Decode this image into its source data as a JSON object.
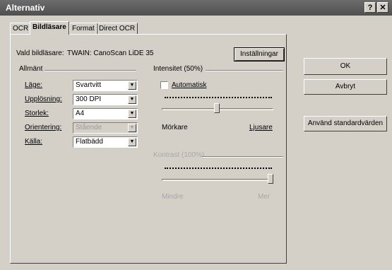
{
  "window": {
    "title": "Alternativ",
    "help_glyph": "?",
    "close_glyph": "✕"
  },
  "tabs": [
    {
      "label": "OCR",
      "active": false
    },
    {
      "label": "Bildläsare",
      "active": true
    },
    {
      "label": "Format",
      "active": false
    },
    {
      "label": "Direct OCR",
      "active": false
    }
  ],
  "scanner": {
    "label": "Vald bildläsare:",
    "value": "TWAIN: CanoScan LiDE 35",
    "settings_button": "Inställningar"
  },
  "general": {
    "title": "Allmänt",
    "fields": [
      {
        "label": "Läge:",
        "value": "Svartvitt",
        "enabled": true
      },
      {
        "label": "Upplösning:",
        "value": "300 DPI",
        "enabled": true
      },
      {
        "label": "Storlek:",
        "value": "A4",
        "enabled": true
      },
      {
        "label": "Orientering:",
        "value": "Stående",
        "enabled": false
      },
      {
        "label": "Källa:",
        "value": "Flatbädd",
        "enabled": true
      }
    ]
  },
  "intensity": {
    "title": "Intensitet (50%)",
    "auto_label": "Automatisk",
    "auto_checked": false,
    "value_percent": 50,
    "min_label": "Mörkare",
    "max_label": "Ljusare"
  },
  "contrast": {
    "title": "Kontrast (100%)",
    "value_percent": 100,
    "min_label": "Mindre",
    "max_label": "Mer",
    "enabled": false
  },
  "buttons": {
    "ok": "OK",
    "cancel": "Avbryt",
    "defaults": "Använd standardvärden"
  }
}
